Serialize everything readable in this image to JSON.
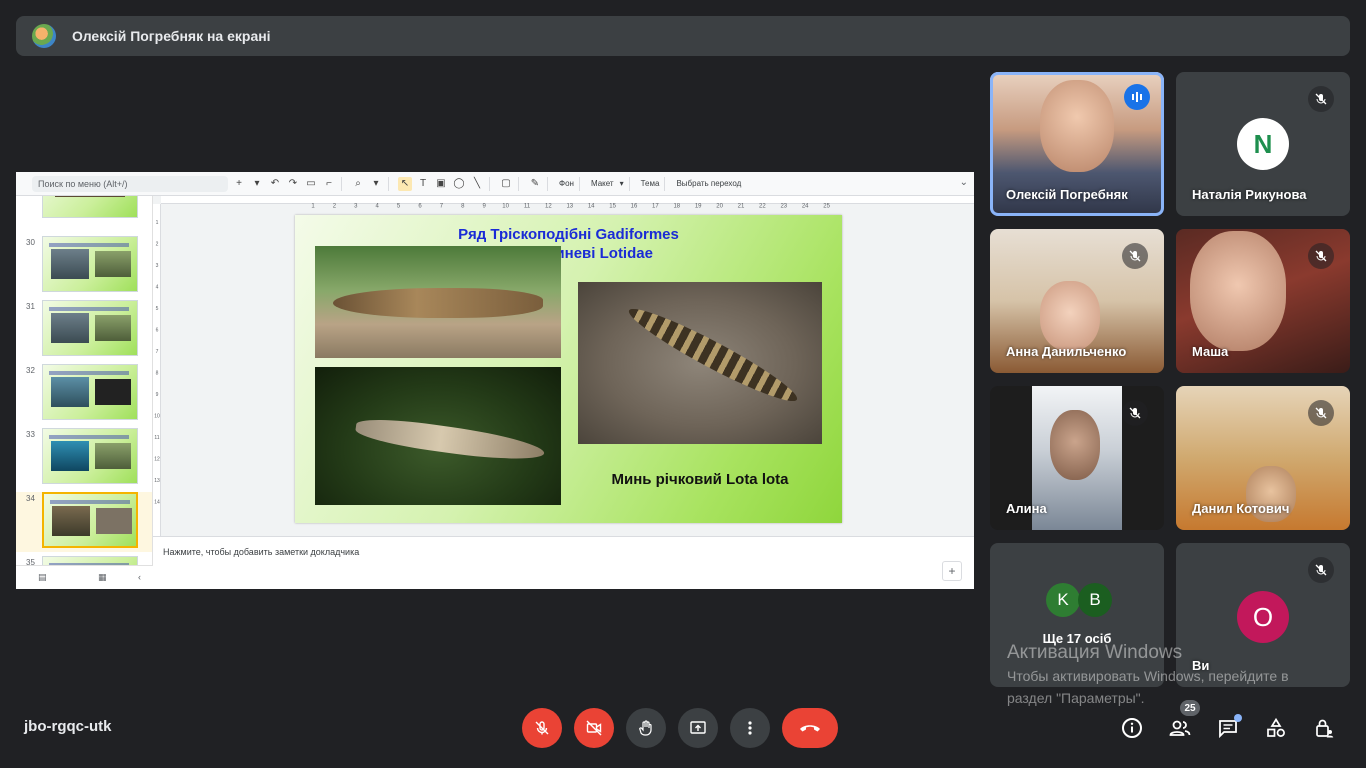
{
  "banner": {
    "title": "Олексій Погребняк на екрані"
  },
  "presentation": {
    "search_placeholder": "Поиск по меню (Alt+/)",
    "toolbar": {
      "background": "Фон",
      "layout": "Макет",
      "theme": "Тема",
      "transition": "Выбрать переход"
    },
    "ruler_ticks": [
      "1",
      "2",
      "3",
      "4",
      "5",
      "6",
      "7",
      "8",
      "9",
      "10",
      "11",
      "12",
      "13",
      "14",
      "15",
      "16",
      "17",
      "18",
      "19",
      "20",
      "21",
      "22",
      "23",
      "24",
      "25"
    ],
    "ruler_v_ticks": [
      "1",
      "2",
      "3",
      "4",
      "5",
      "6",
      "7",
      "8",
      "9",
      "10",
      "11",
      "12",
      "13",
      "14"
    ],
    "thumbnails": [
      {
        "num": ""
      },
      {
        "num": "30"
      },
      {
        "num": "31"
      },
      {
        "num": "32"
      },
      {
        "num": "33"
      },
      {
        "num": "34"
      },
      {
        "num": "35"
      }
    ],
    "active_slide": "34",
    "slide": {
      "title_line1": "Ряд Тріскоподібні Gadiformes",
      "title_line2": "Родина Миневі Lotidae",
      "caption": "Минь річковий Lota lota"
    },
    "notes_placeholder": "Нажмите, чтобы добавить заметки докладчика"
  },
  "participants": [
    {
      "name": "Олексій Погребняк",
      "speaking": true
    },
    {
      "name": "Наталія Рикунова",
      "avatar_letter": "N",
      "muted": true
    },
    {
      "name": "Анна Данильченко",
      "muted": true
    },
    {
      "name": "Маша",
      "muted": true
    },
    {
      "name": "Алина",
      "muted": true
    },
    {
      "name": "Данил Котович",
      "muted": true
    },
    {
      "more_label": "Ще 17 осіб",
      "avatars": [
        "K",
        "B"
      ]
    },
    {
      "name": "Ви",
      "avatar_letter": "O",
      "muted": true
    }
  ],
  "watermark": {
    "line1": "Активация Windows",
    "line2": "Чтобы активировать Windows, перейдите в",
    "line3": "раздел \"Параметры\"."
  },
  "bottom": {
    "meeting_code": "jbo-rgqc-utk",
    "people_count": "25"
  },
  "colors": {
    "accent_red": "#ea4335",
    "tile_bg": "#3c4043",
    "page_bg": "#202124",
    "speaking_blue": "#1a73e8"
  }
}
